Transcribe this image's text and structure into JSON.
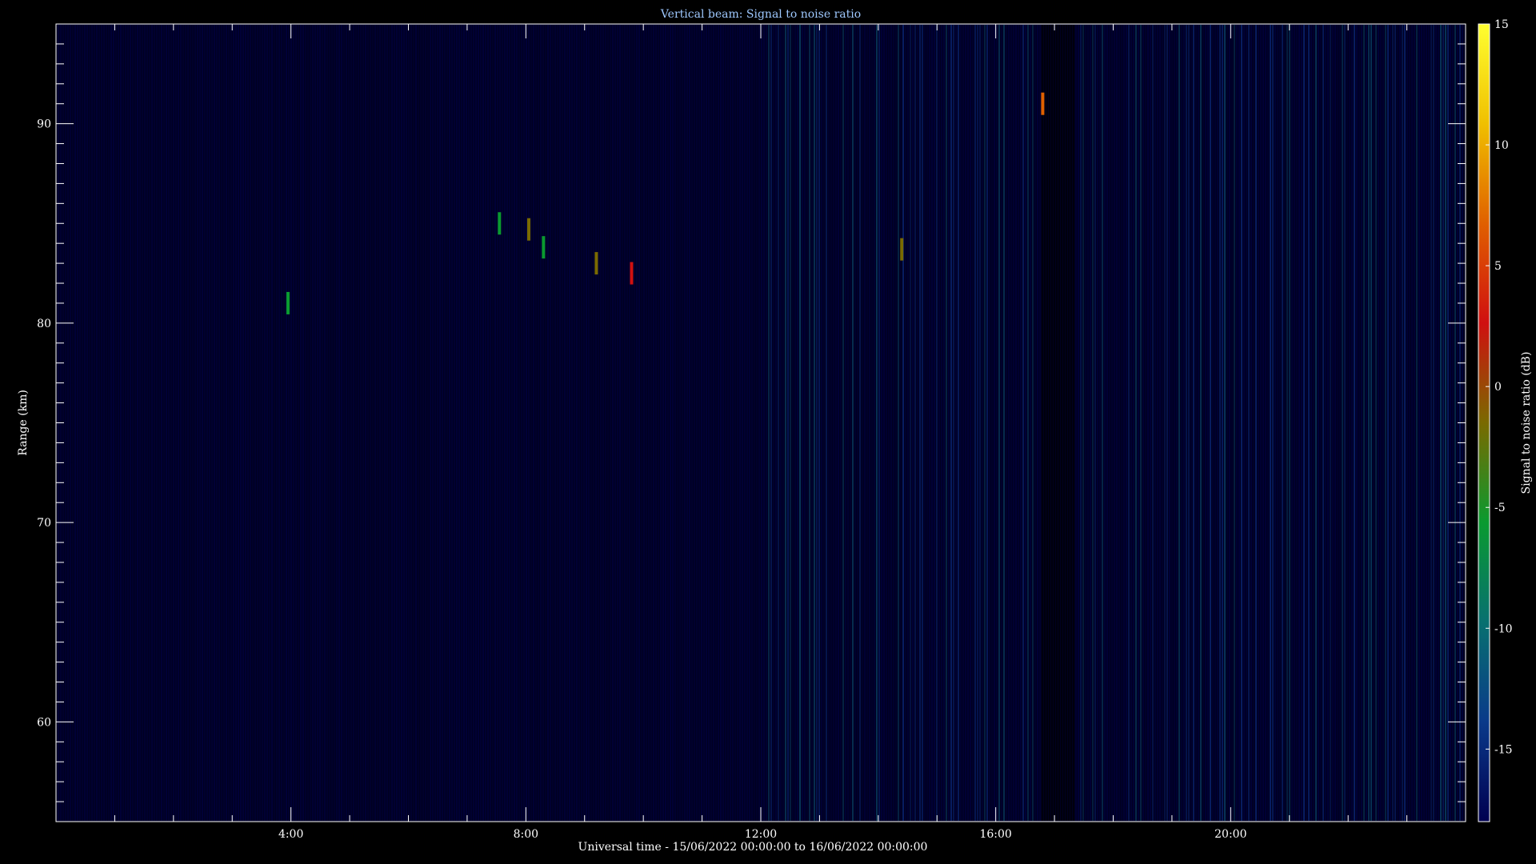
{
  "chart_data": {
    "type": "heatmap",
    "title": "Vertical beam: Signal to noise ratio",
    "xlabel": "Universal time - 15/06/2022 00:00:00 to 16/06/2022 00:00:00",
    "ylabel": "Range (km)",
    "xlim_hours": [
      0,
      24
    ],
    "ylim": [
      55,
      95
    ],
    "x_ticks": [
      "4:00",
      "8:00",
      "12:00",
      "16:00",
      "20:00"
    ],
    "x_tick_hours": [
      4,
      8,
      12,
      16,
      20
    ],
    "y_ticks": [
      60,
      70,
      80,
      90
    ],
    "colorbar": {
      "label": "Signal to noise ratio (dB)",
      "range": [
        -18,
        15
      ],
      "ticks": [
        15,
        10,
        5,
        0,
        -5,
        -10,
        -15
      ],
      "colors": [
        "#000050",
        "#0a3a8a",
        "#087070",
        "#0a9a30",
        "#7a6a00",
        "#d01010",
        "#e06000",
        "#f0c000",
        "#ffff30"
      ]
    },
    "grid": false,
    "background": "#000020",
    "features": [
      {
        "hour": 3.95,
        "range": 81,
        "snr": -7
      },
      {
        "hour": 7.55,
        "range": 85,
        "snr": -6
      },
      {
        "hour": 8.05,
        "range": 84.7,
        "snr": -5
      },
      {
        "hour": 8.3,
        "range": 83.8,
        "snr": -6
      },
      {
        "hour": 9.2,
        "range": 83,
        "snr": -3
      },
      {
        "hour": 9.8,
        "range": 82.5,
        "snr": 2
      },
      {
        "hour": 14.4,
        "range": 83.7,
        "snr": -4
      },
      {
        "hour": 16.8,
        "range": 91,
        "snr": 6
      }
    ]
  }
}
